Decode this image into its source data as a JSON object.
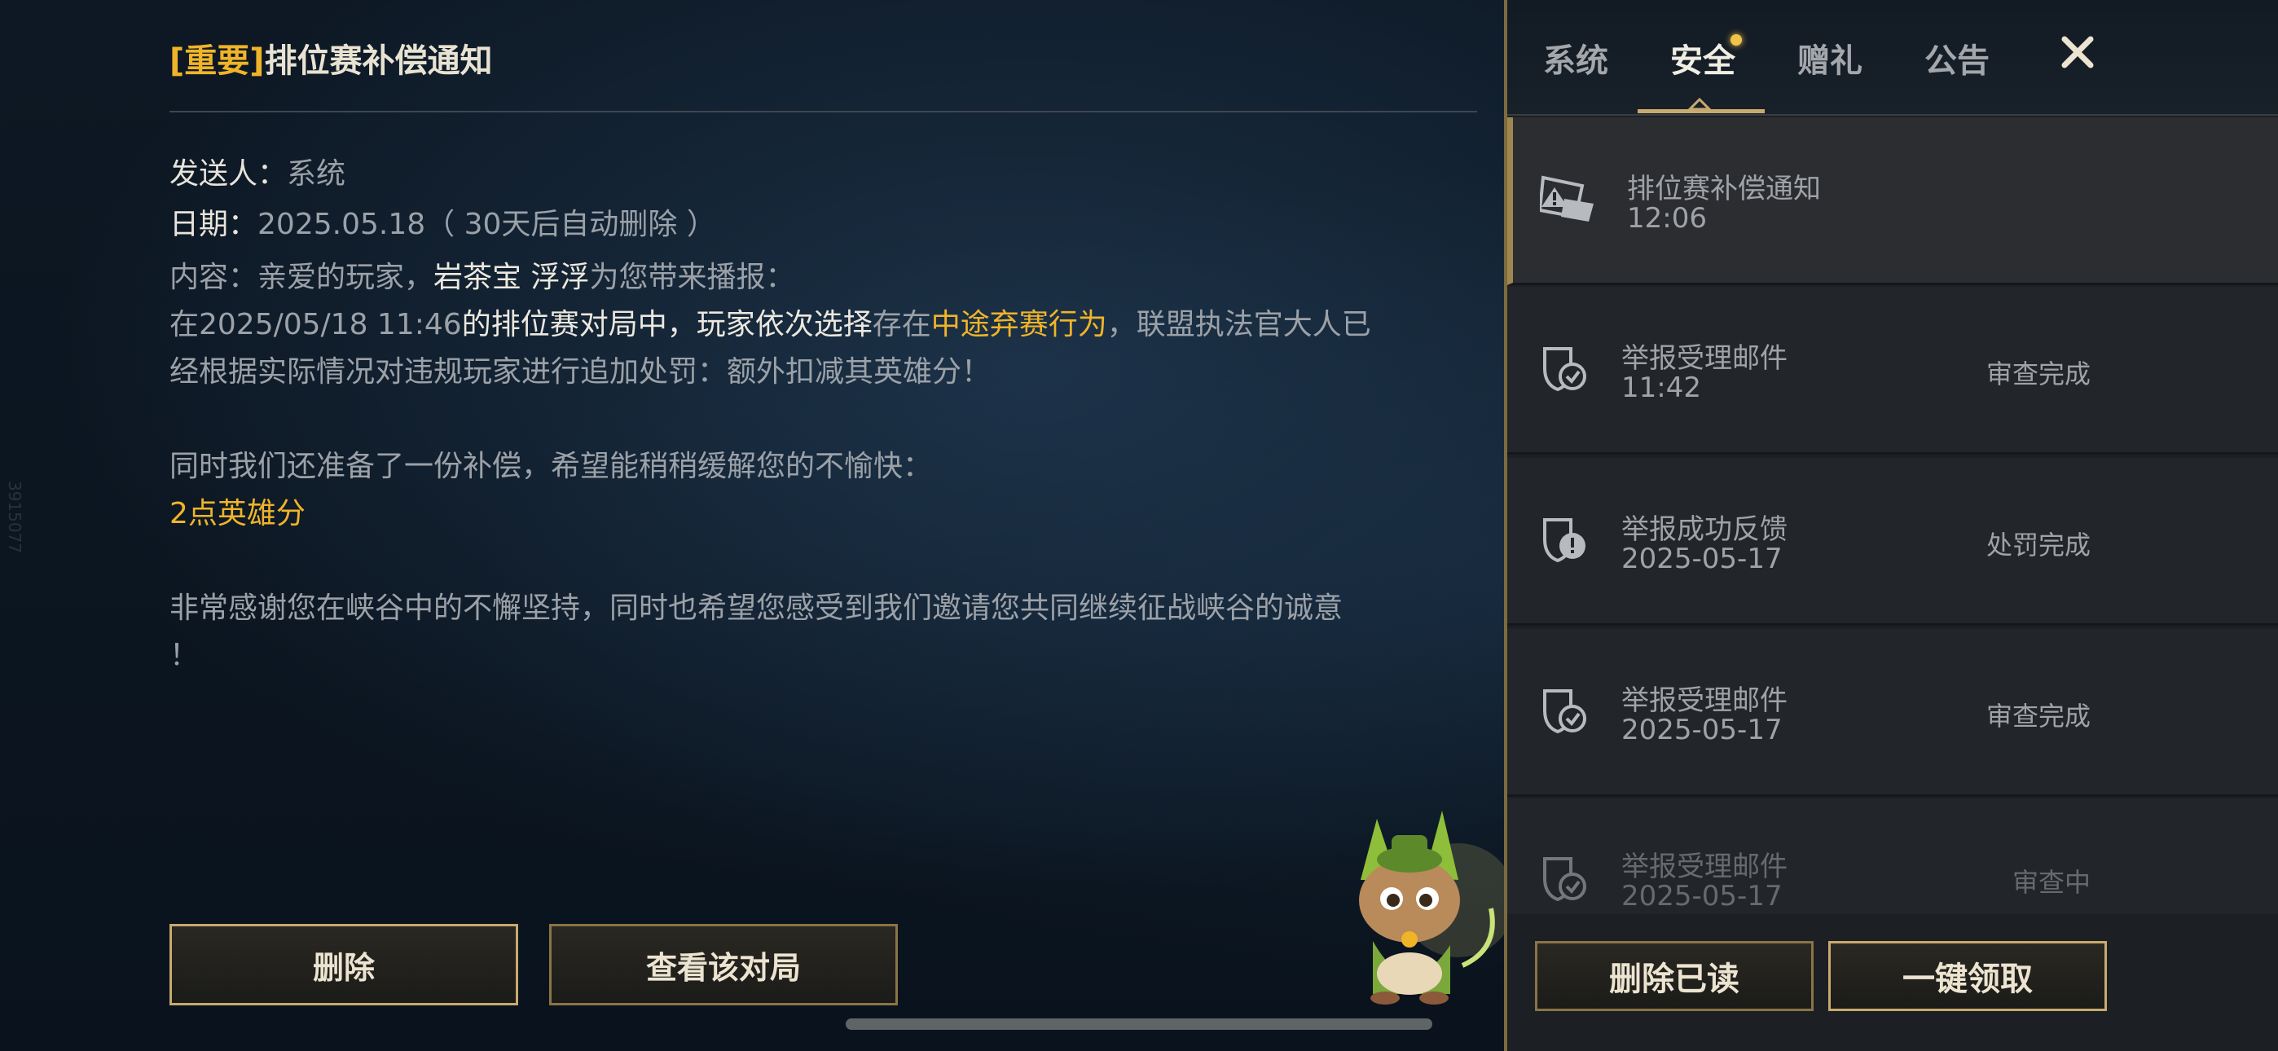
{
  "watermark": "3915077",
  "mail": {
    "title_tag": "[重要]",
    "title": "排位赛补偿通知",
    "sender_label": "发送人：",
    "sender": "系统",
    "date_label": "日期：",
    "date": "2025.05.18（ 30天后自动删除 ）",
    "content_prefix": "内容：亲爱的玩家，",
    "player_name": "岩茶宝 浮浮",
    "content_suffix": "为您带来播报：",
    "line2_part1": "在2025/05/18 11:46",
    "line2_part2": "的排位赛对局中，玩家",
    "line2_part3": "依次选择",
    "line2_part4": "存在",
    "line2_part5": "中途弃赛行为",
    "line2_part6": "，联盟执法官大人已",
    "line3": "经根据实际情况对违规玩家进行追加处罚：额外扣减其英雄分！",
    "line4": "同时我们还准备了一份补偿，希望能稍稍缓解您的不愉快：",
    "reward": "2点英雄分",
    "line6": "非常感谢您在峡谷中的不懈坚持，同时也希望您感受到我们邀请您共同继续征战峡谷的诚意",
    "line7": "！",
    "delete_button": "删除",
    "view_match_button": "查看该对局"
  },
  "panel": {
    "tabs": [
      {
        "label": "系统"
      },
      {
        "label": "安全"
      },
      {
        "label": "赠礼"
      },
      {
        "label": "公告"
      }
    ],
    "active_tab": "安全",
    "close_icon": "close-icon",
    "items": [
      {
        "title": "排位赛补偿通知",
        "time": "12:06",
        "status": "",
        "icon": "warning-mail-icon"
      },
      {
        "title": "举报受理邮件",
        "time": "11:42",
        "status": "审查完成",
        "icon": "shield-check-icon"
      },
      {
        "title": "举报成功反馈",
        "time": "2025-05-17",
        "status": "处罚完成",
        "icon": "shield-alert-icon"
      },
      {
        "title": "举报受理邮件",
        "time": "2025-05-17",
        "status": "审查完成",
        "icon": "shield-check-icon"
      },
      {
        "title": "举报受理邮件",
        "time": "2025-05-17",
        "status": "审查中",
        "icon": "shield-check-icon"
      }
    ],
    "delete_read_button": "删除已读",
    "claim_all_button": "一键领取"
  },
  "colors": {
    "gold_accent": "#f0b429",
    "button_border": "#c8aa6e",
    "panel_bg": "#1c1f23"
  }
}
